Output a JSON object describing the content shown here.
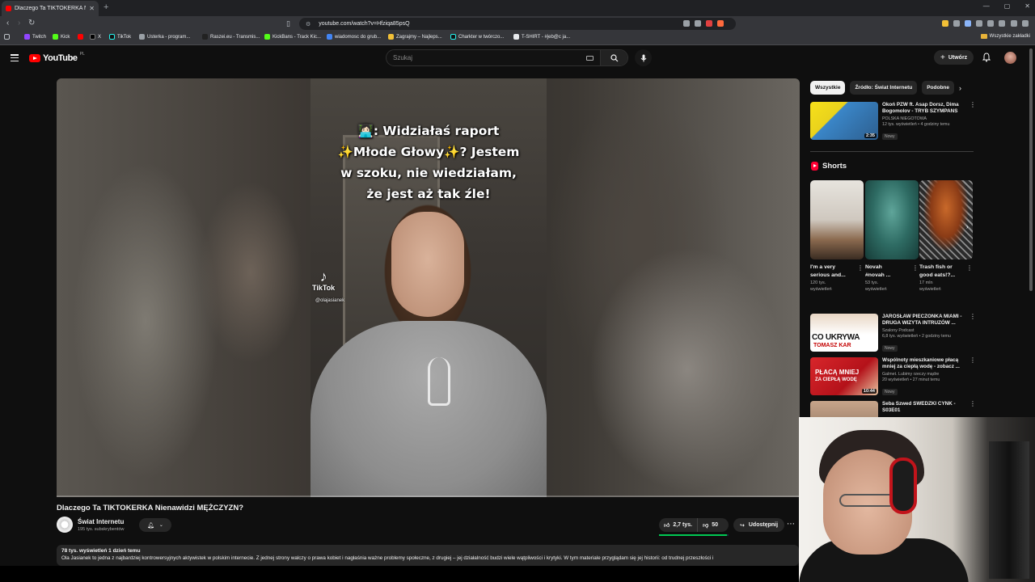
{
  "browser": {
    "tab_title": "Dlaczego Ta TIKTOKERKA Nie",
    "new_tab": "+",
    "window_controls": [
      "—",
      "▢",
      "✕"
    ],
    "url": "youtube.com/watch?v=Hfziqa85psQ",
    "bookmarks": [
      "Twitch",
      "Kick",
      "",
      "X",
      "TikTok",
      "Usterka - program...",
      "Raszei.eu - Transmis...",
      "KickBans - Track Kic...",
      "wiadomosc do grub...",
      "Zagrajmy – Najleps...",
      "Charkter w twórczo...",
      "T-SHIRT - #jeb@c ja..."
    ],
    "all_bookmarks": "Wszystkie zakładki"
  },
  "header": {
    "logo_text": "YouTube",
    "region": "PL",
    "search_placeholder": "Szukaj",
    "create_label": "Utwórz"
  },
  "video": {
    "overlay_lines": [
      "👩🏻‍💻: Widziałaś raport",
      "✨Młode Głowy✨? Jestem",
      "w szoku, nie wiedziałam,",
      "że jest aż tak źle!"
    ],
    "tiktok_label": "TikTok",
    "tiktok_user": "@olajasianek",
    "title": "Dlaczego Ta TIKTOKERKA Nienawidzi MĘŻCZYZN?",
    "channel_name": "Świat Internetu",
    "channel_subs": "195 tys. subskrybentów",
    "likes": "2,7 tys.",
    "dislikes": "50",
    "like_ratio": 0.98,
    "share_label": "Udostępnij",
    "description_meta": "78 tys. wyświetleń  1 dzień temu",
    "description_text": "Ola Jasianek to jedna z najbardziej kontrowersyjnych aktywistek w polskim internecie. Z jednej strony walczy o prawa kobiet i nagłaśnia ważne problemy społeczne, z drugiej – jej działalność budzi wiele wątpliwości i krytyki. W tym materiale przyglądam się jej historii: od trudnej przeszłości i"
  },
  "sidebar": {
    "chips": [
      "Wszystkie",
      "Źródło: Świat Internetu",
      "Podobne"
    ],
    "top_rec": {
      "title": "Okoń PZW ft. Asap Dorsz, Dima Bogomolov - TRYB SZYMPANS",
      "channel": "POLSKA NIEGOTOWA",
      "meta": "12 tys. wyświetleń • 4 godziny temu",
      "badge": "Nowy",
      "duration": "2:35"
    },
    "shorts_title": "Shorts",
    "shorts": [
      {
        "title1": "I'm a very",
        "title2": "serious and...",
        "views1": "120 tys.",
        "views2": "wyświetleń"
      },
      {
        "title1": "Novah",
        "title2": "#novah ...",
        "views1": "53 tys.",
        "views2": "wyświetleń"
      },
      {
        "title1": "Trash fish or",
        "title2": "good eats!?...",
        "views1": "17 mln",
        "views2": "wyświetleń"
      }
    ],
    "recs": [
      {
        "title": "JAROSŁAW PIECZONKA MIAMI - DRUGA WIZYTA INTRUZÓW ...",
        "channel": "Szalony Podcast",
        "meta": "6,8 tys. wyświetleń • 2 godziny temu",
        "badge": "Nowy",
        "duration": "",
        "thumb_text": "CO UKRYWA",
        "thumb_text2": "TOMASZ KAR"
      },
      {
        "title": "Wspólnoty mieszkaniowe płacą mniej za ciepłą wodę - zobacz ...",
        "channel": "Galmet. Lubimy rzeczy mądre",
        "meta": "20 wyświetleń • 27 minut temu",
        "badge": "Nowy",
        "duration": "10:44",
        "thumb_text": "PŁACĄ MNIEJ",
        "thumb_text2": "ZA CIEPŁĄ WODĘ"
      },
      {
        "title": "Seba Szwed SWEDZKI CYNK - S03E01",
        "channel": "",
        "meta": "",
        "badge": "",
        "duration": "",
        "thumb_text": "",
        "thumb_text2": ""
      }
    ]
  }
}
